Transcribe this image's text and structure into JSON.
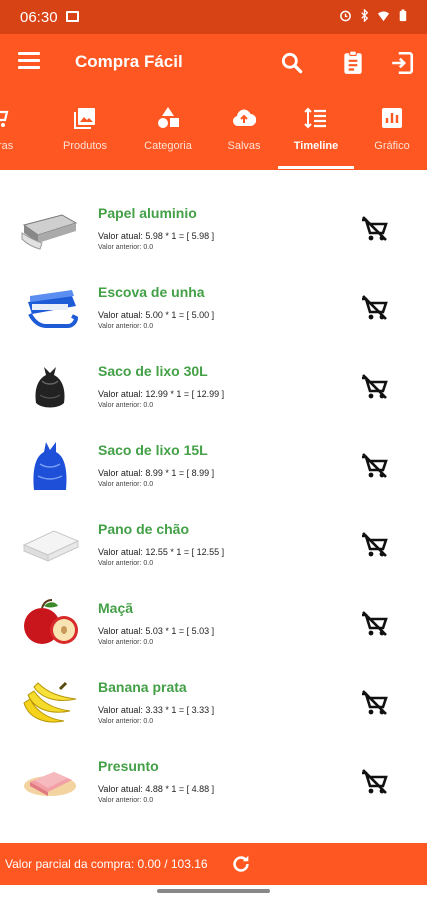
{
  "status_bar": {
    "time": "06:30"
  },
  "app_bar": {
    "title": "Compra Fácil"
  },
  "tabs": [
    {
      "label": "mpras",
      "icon": "cart-icon"
    },
    {
      "label": "Produtos",
      "icon": "image-icon"
    },
    {
      "label": "Categoria",
      "icon": "shapes-icon"
    },
    {
      "label": "Salvas",
      "icon": "cloud-upload-icon"
    },
    {
      "label": "Timeline",
      "icon": "timeline-icon",
      "active": true
    },
    {
      "label": "Gráfico",
      "icon": "chart-icon"
    }
  ],
  "items": [
    {
      "name": "Papel aluminio",
      "current": "Valor atual: 5.98 * 1 = [ 5.98 ]",
      "previous": "Valor anterior: 0.0"
    },
    {
      "name": "Escova de unha",
      "current": "Valor atual: 5.00 * 1 = [ 5.00 ]",
      "previous": "Valor anterior: 0.0"
    },
    {
      "name": "Saco de lixo 30L",
      "current": "Valor atual: 12.99 * 1 = [ 12.99 ]",
      "previous": "Valor anterior: 0.0"
    },
    {
      "name": "Saco de lixo 15L",
      "current": "Valor atual: 8.99 * 1 = [ 8.99 ]",
      "previous": "Valor anterior: 0.0"
    },
    {
      "name": "Pano de chão",
      "current": "Valor atual: 12.55 * 1 = [ 12.55 ]",
      "previous": "Valor anterior: 0.0"
    },
    {
      "name": "Maçã",
      "current": "Valor atual: 5.03 * 1 = [ 5.03 ]",
      "previous": "Valor anterior: 0.0"
    },
    {
      "name": "Banana prata",
      "current": "Valor atual: 3.33 * 1 = [ 3.33 ]",
      "previous": "Valor anterior: 0.0"
    },
    {
      "name": "Presunto",
      "current": "Valor atual: 4.88 * 1 = [ 4.88 ]",
      "previous": "Valor anterior: 0.0"
    }
  ],
  "footer": {
    "text": "Valor parcial da compra: 0.00 / 103.16"
  },
  "colors": {
    "primary": "#ff5722",
    "status": "#d84315",
    "item_name": "#43a047"
  }
}
